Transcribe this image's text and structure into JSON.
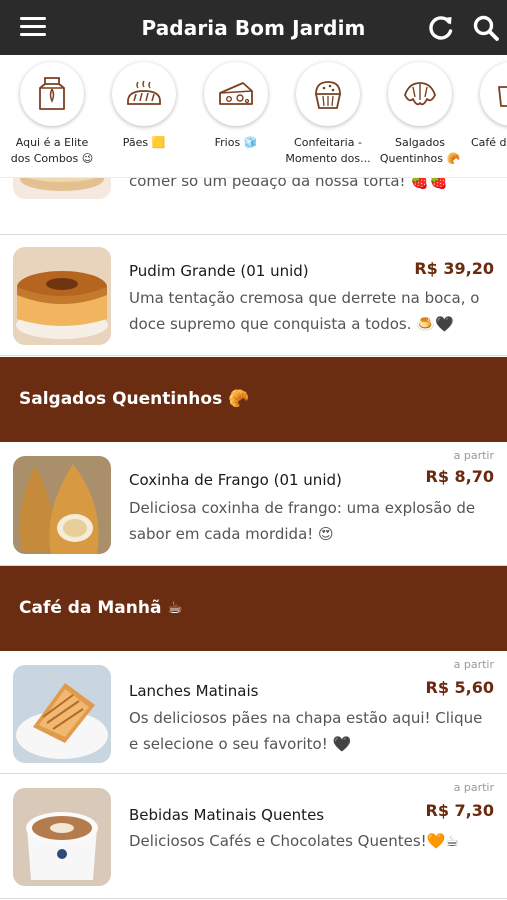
{
  "header": {
    "title": "Padaria Bom Jardim",
    "menu_icon": "hamburger-menu-icon",
    "refresh_icon": "refresh-icon",
    "search_icon": "search-icon"
  },
  "categories": [
    {
      "label": "Aqui é a Elite dos Combos 😉",
      "icon": "shopping-bag-icon"
    },
    {
      "label": "Pães 🟨",
      "icon": "bread-icon"
    },
    {
      "label": "Frios 🧊",
      "icon": "cheese-icon"
    },
    {
      "label": "Confeitaria - Momento dos...",
      "icon": "cupcake-icon"
    },
    {
      "label": "Salgados Quentinhos 🥐",
      "icon": "croissant-icon"
    },
    {
      "label": "Café da M...",
      "icon": "coffee-cup-icon"
    }
  ],
  "products": [
    {
      "name": "",
      "desc": "Olha esses morangos vermelhinhos! Difícil é comer só um pedaço da nossa torta! 🍓🍓",
      "from": "",
      "price": ""
    },
    {
      "name": "Pudim Grande (01 unid)",
      "desc": "Uma tentação cremosa que derrete na boca, o doce supremo que conquista a todos. 🍮🖤",
      "from": "",
      "price": "R$ 39,20"
    },
    {
      "name": "Coxinha de Frango (01 unid)",
      "desc": "Deliciosa coxinha de frango: uma explosão de sabor em cada mordida! 😍",
      "from": "a partir",
      "price": "R$ 8,70"
    },
    {
      "name": "Lanches Matinais",
      "desc": "Os deliciosos pães na chapa estão aqui! Clique e selecione o seu favorito! 🖤",
      "from": "a partir",
      "price": "R$ 5,60"
    },
    {
      "name": "Bebidas Matinais Quentes",
      "desc": "Deliciosos Cafés e Chocolates Quentes!🧡☕",
      "from": "a partir",
      "price": "R$ 7,30"
    }
  ],
  "sections": [
    {
      "title": "Salgados Quentinhos 🥐"
    },
    {
      "title": "Café da Manhã ☕"
    }
  ],
  "colors": {
    "header_bg": "#2b2b2b",
    "section_bg": "#6b2d12",
    "price": "#6b2a0e"
  }
}
